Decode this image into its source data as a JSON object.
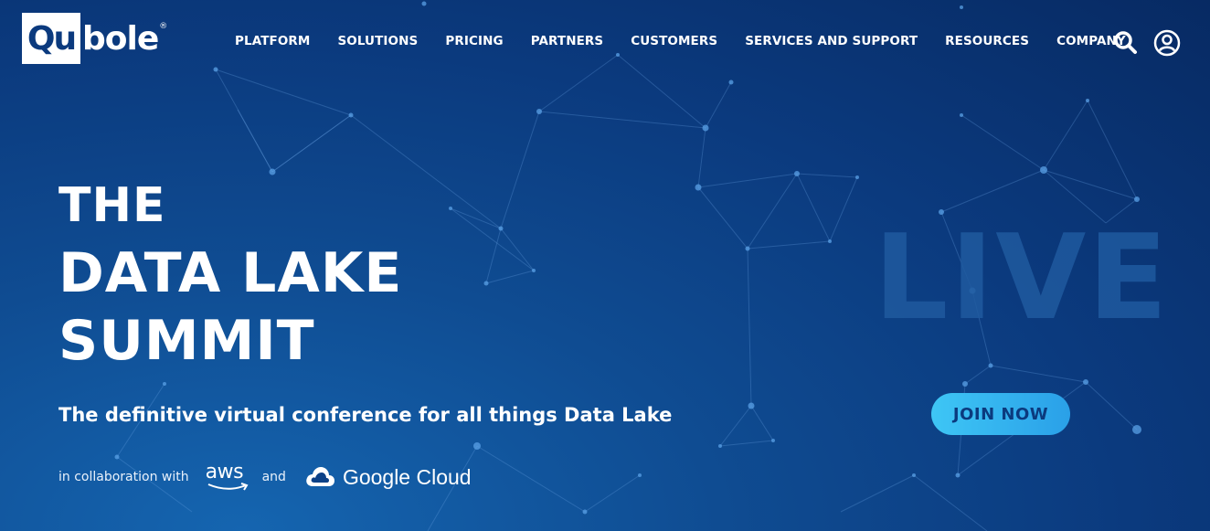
{
  "brand": {
    "logo_boxed": "Qu",
    "logo_rest": "bole",
    "registered": "®"
  },
  "nav": {
    "items": [
      {
        "label": "PLATFORM"
      },
      {
        "label": "SOLUTIONS"
      },
      {
        "label": "PRICING"
      },
      {
        "label": "PARTNERS"
      },
      {
        "label": "CUSTOMERS"
      },
      {
        "label": "SERVICES AND SUPPORT"
      },
      {
        "label": "RESOURCES"
      },
      {
        "label": "COMPANY"
      }
    ],
    "icons": [
      "search-icon",
      "user-account-icon"
    ]
  },
  "hero": {
    "line1": "THE",
    "line2": "DATA LAKE",
    "line3": "SUMMIT",
    "subtitle": "The definitive virtual conference for all things Data Lake",
    "collab_prefix": "in collaboration with",
    "partner1": "aws",
    "and": "and",
    "partner2": "Google Cloud",
    "badge": "LIVE",
    "cta": "JOIN NOW"
  },
  "colors": {
    "background": "#0b3a7e",
    "cta_gradient_start": "#3ec6f5",
    "cta_gradient_end": "#2aa0e8",
    "cta_text": "#0b3a7e",
    "live_text": "#1f5a9f"
  }
}
